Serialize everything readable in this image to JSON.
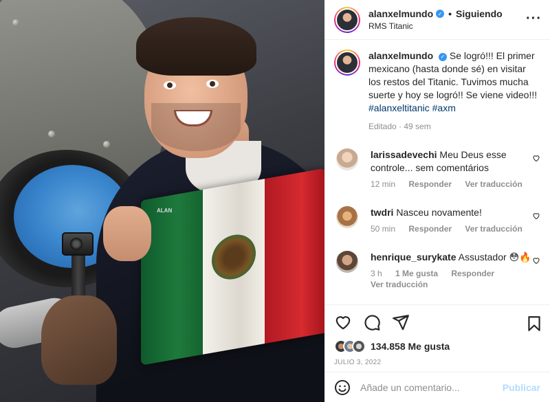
{
  "post": {
    "username": "alanxelmundo",
    "follow_state": "Siguiendo",
    "separator": "•",
    "location": "RMS Titanic",
    "more_icon": "more-dots-icon",
    "flag_tag": "ALAN"
  },
  "caption": {
    "username": "alanxelmundo",
    "text": "Se logró!!! El primer mexicano (hasta donde sé) en visitar los restos del Titanic. Tuvimos mucha suerte y hoy se logró!! Se viene video!!! ",
    "hashtag1": "#alanxeltitanic",
    "hashtag2": "#axm",
    "edited": "Editado · 49 sem"
  },
  "comments": [
    {
      "username": "larissadevechi",
      "text": "Meu Deus esse controle... sem comentários",
      "time": "12 min",
      "reply": "Responder",
      "translate": "Ver traducción",
      "avatar_color": "#d9c6b4"
    },
    {
      "username": "twdri",
      "text": "Nasceu novamente!",
      "time": "50 min",
      "reply": "Responder",
      "translate": "Ver traducción",
      "avatar_color": "#c89a6a"
    },
    {
      "username": "henrique_surykate",
      "text": "Assustador 😳🔥",
      "time": "3 h",
      "likes": "1 Me gusta",
      "reply": "Responder",
      "translate": "Ver traducción",
      "avatar_color": "#6b5a4e"
    }
  ],
  "actions": {
    "likes_count": "134.858 Me gusta",
    "date": "JULIO 3, 2022",
    "icons": [
      "heart-icon",
      "comment-icon",
      "share-icon",
      "bookmark-icon"
    ]
  },
  "add_comment": {
    "placeholder": "Añade un comentario...",
    "publish_label": "Publicar"
  },
  "colors": {
    "verified": "#3897f0",
    "hashtag": "#00376b",
    "muted": "#8e8e8e",
    "publish_disabled": "#b3dbff"
  }
}
